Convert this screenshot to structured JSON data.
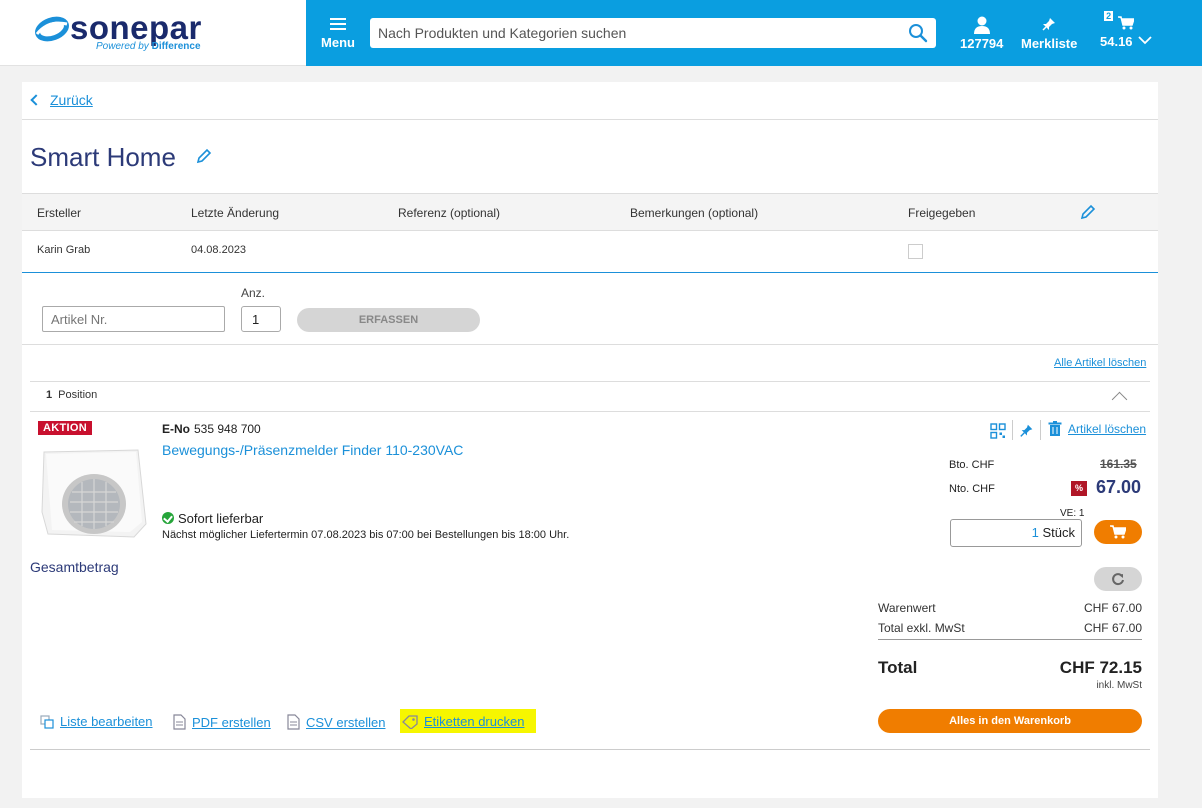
{
  "header": {
    "logo_text": "sonepar",
    "logo_tagline_prefix": "Powered by",
    "logo_tagline_brand": "Difference",
    "menu_label": "Menu",
    "search_placeholder": "Nach Produkten und Kategorien suchen",
    "account_label": "127794",
    "wishlist_label": "Merkliste",
    "cart_count": "2",
    "cart_total": "54.16"
  },
  "page": {
    "back_label": "Zurück",
    "title": "Smart Home"
  },
  "info_table": {
    "headers": [
      "Ersteller",
      "Letzte Änderung",
      "Referenz (optional)",
      "Bemerkungen (optional)",
      "Freigegeben"
    ],
    "values": {
      "creator": "Karin Grab",
      "last_change": "04.08.2023",
      "reference": "",
      "remarks": "",
      "released": false
    }
  },
  "quick_add": {
    "article_placeholder": "Artikel Nr.",
    "qty_label": "Anz.",
    "qty_value": "1",
    "submit_label": "ERFASSEN"
  },
  "list": {
    "delete_all_label": "Alle Artikel löschen",
    "position_count": "1",
    "position_label": "Position"
  },
  "item": {
    "badge": "AKTION",
    "eno_label": "E-No",
    "eno_value": "535 948 700",
    "name": "Bewegungs-/Präsenzmelder Finder 110-230VAC",
    "availability": "Sofort lieferbar",
    "delivery_note": "Nächst möglicher Liefertermin 07.08.2023 bis 07:00 bei Bestellungen bis 18:00 Uhr.",
    "delete_label": "Artikel löschen",
    "gross_label": "Bto. CHF",
    "gross_price": "161.35",
    "net_label": "Nto. CHF",
    "discount_badge": "%",
    "net_price": "67.00",
    "ve_label": "VE: 1",
    "qty_value": "1",
    "qty_unit": "Stück"
  },
  "summary": {
    "total_heading": "Gesamtbetrag",
    "goods_label": "Warenwert",
    "goods_value": "CHF 67.00",
    "excl_label": "Total exkl. MwSt",
    "excl_value": "CHF 67.00",
    "total_label": "Total",
    "total_value": "CHF 72.15",
    "incl_note": "inkl. MwSt",
    "buy_all_label": "Alles in den Warenkorb"
  },
  "actions": {
    "edit_list": "Liste bearbeiten",
    "create_pdf": "PDF erstellen",
    "create_csv": "CSV erstellen",
    "print_labels": "Etiketten drucken"
  },
  "colors": {
    "brand_blue": "#0a9ee0",
    "navy": "#2c3a78",
    "orange": "#f07d00",
    "promo_red": "#c8102e",
    "highlight": "#f6f600"
  }
}
